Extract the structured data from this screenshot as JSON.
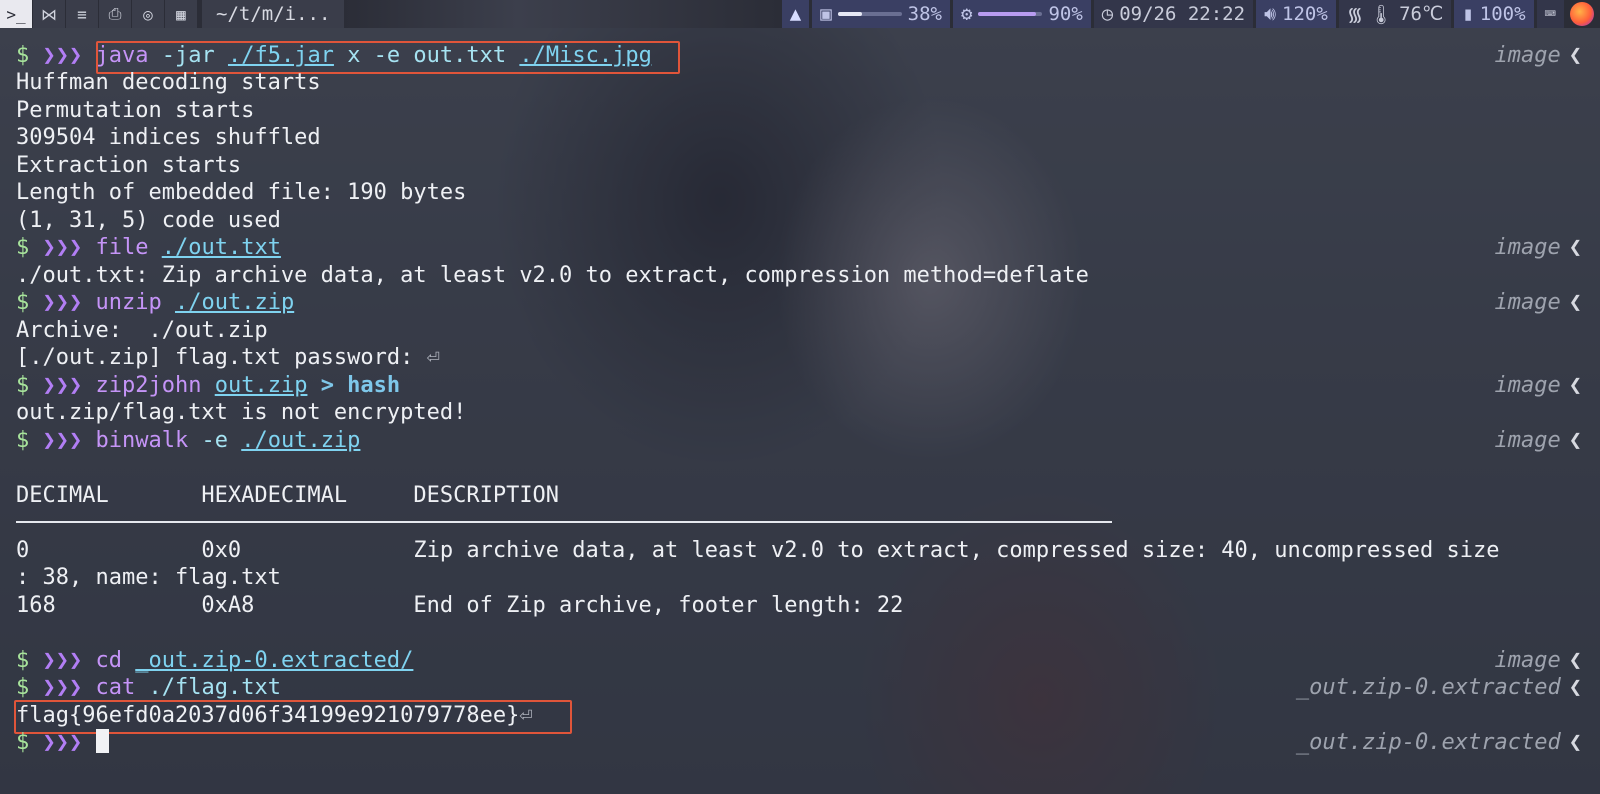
{
  "topbar": {
    "title": "~/t/m/i...",
    "brightness": "38%",
    "brightness_level": 0.38,
    "cpu": "90%",
    "cpu_level": 0.9,
    "clock": "09/26 22:22",
    "volume": "120%",
    "temp": "76℃",
    "battery": "100%"
  },
  "prompt": {
    "dollar": "$",
    "arrows": "❯❯❯",
    "return_glyph": "⏎",
    "chevron": "❮"
  },
  "lines": {
    "l0": {
      "cmd": "java",
      "a1": "-jar",
      "p1": "./f5.jar",
      "a2": "x -e out.txt",
      "p2": "./Misc.jpg",
      "rp": "image"
    },
    "o1": "Huffman decoding starts",
    "o2": "Permutation starts",
    "o3": "309504 indices shuffled",
    "o4": "Extraction starts",
    "o5": "Length of embedded file: 190 bytes",
    "o6": "(1, 31, 5) code used",
    "l7": {
      "cmd": "file",
      "p1": "./out.txt",
      "rp": "image"
    },
    "o8": "./out.txt: Zip archive data, at least v2.0 to extract, compression method=deflate",
    "l9": {
      "cmd": "unzip",
      "p1": "./out.zip",
      "rp": "image"
    },
    "o10": "Archive:  ./out.zip",
    "o11": "[./out.zip] flag.txt password: ",
    "l12": {
      "cmd": "zip2john",
      "p1": "out.zip",
      "op": "> hash",
      "rp": "image"
    },
    "o13": "out.zip/flag.txt is not encrypted!",
    "l14": {
      "cmd": "binwalk",
      "a1": "-e",
      "p1": "./out.zip",
      "rp": "image"
    },
    "o16": "DECIMAL       HEXADECIMAL     DESCRIPTION",
    "o18": "0             0x0             Zip archive data, at least v2.0 to extract, compressed size: 40, uncompressed size",
    "o19": ": 38, name: flag.txt",
    "o20": "168           0xA8            End of Zip archive, footer length: 22",
    "l22": {
      "cmd": "cd",
      "p1": "_out.zip-0.extracted/",
      "rp": "image"
    },
    "l23": {
      "cmd": "cat",
      "p1": "./flag.txt",
      "rp": "_out.zip-0.extracted"
    },
    "o24": "flag{96efd0a2037d06f34199e921079778ee}",
    "l25": {
      "rp": "_out.zip-0.extracted"
    }
  }
}
